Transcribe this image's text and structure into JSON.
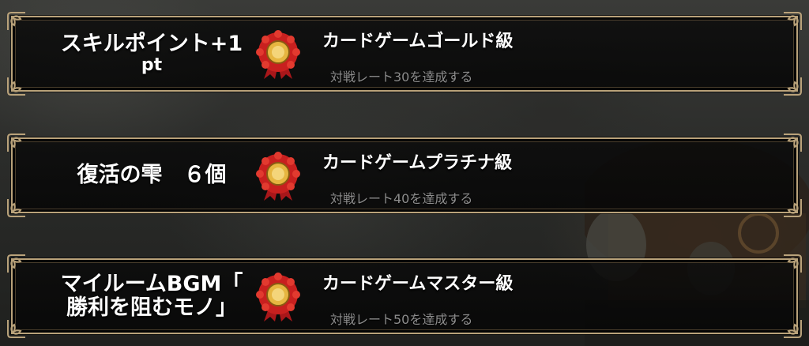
{
  "achievements": [
    {
      "reward_line1": "スキルポイント+1",
      "reward_line2": "pt",
      "medal_icon": "rosette-medal-icon",
      "title": "カードゲームゴールド級",
      "condition": "対戦レート30を達成する"
    },
    {
      "reward_line1": "復活の雫　６個",
      "reward_line2": "",
      "medal_icon": "rosette-medal-icon",
      "title": "カードゲームプラチナ級",
      "condition": "対戦レート40を達成する"
    },
    {
      "reward_line1": "マイルームBGM「",
      "reward_line2": "勝利を阻むモノ」",
      "medal_icon": "rosette-medal-icon",
      "title": "カードゲームマスター級",
      "condition": "対戦レート50を達成する"
    }
  ],
  "colors": {
    "frame": "#b9a27a",
    "title_text": "#ffffff",
    "condition_text": "#8d8d8d",
    "medal_red": "#c8201f",
    "medal_gold": "#e6b640"
  }
}
